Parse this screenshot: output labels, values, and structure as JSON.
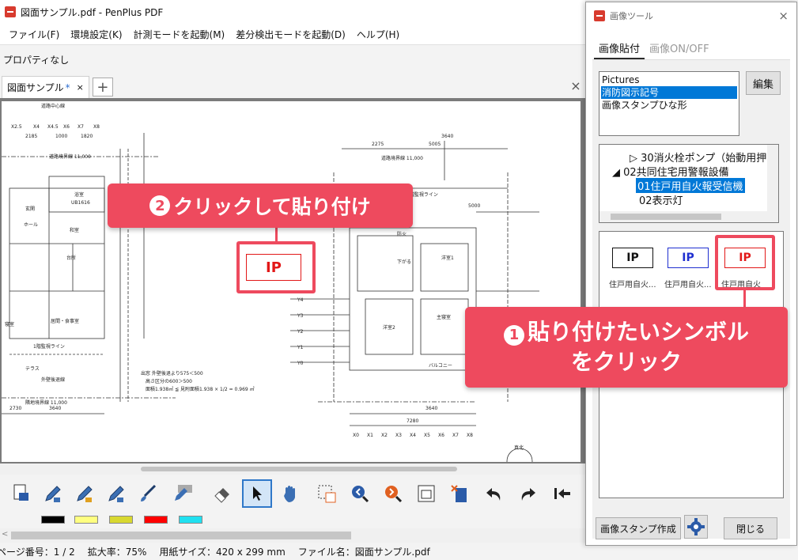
{
  "window": {
    "title": "図面サンプル.pdf - PenPlus PDF"
  },
  "menu": [
    "ファイル(F)",
    "環境設定(K)",
    "計測モードを起動(M)",
    "差分検出モードを起動(D)",
    "ヘルプ(H)"
  ],
  "properties": {
    "label": "プロパティなし"
  },
  "tab": {
    "label": "図面サンプル",
    "modified": "*",
    "close": "×",
    "add": "+",
    "close_all": "×"
  },
  "drawing": {
    "labels": [
      "道路中心線",
      "道路境界線 11,000",
      "道路境界線 11,000",
      "玄関",
      "ホール",
      "台所",
      "居間・食事室",
      "寝室",
      "浴室",
      "UB1616",
      "和室",
      "洋室1",
      "洋室2",
      "主寝室",
      "下がる",
      "テラス",
      "バルコニー",
      "外壁後退線",
      "隣地境界線 11,000",
      "1階監視ライン",
      "2階監視ライン",
      "真北",
      "防火"
    ],
    "notes": [
      "出窓 外壁後退より575＜500",
      "高さ区分の600＞500",
      "面積1.938㎡ ≦ 見附面積1.938 × 1/2 = 0.969 ㎡"
    ],
    "grid_x": [
      "X2.5",
      "X4",
      "X4.5",
      "X6",
      "X7",
      "X8"
    ],
    "grid_y": [
      "Y4",
      "Y3",
      "Y2",
      "Y1",
      "Y0"
    ],
    "grid_bottom": [
      "X0",
      "X1",
      "X2",
      "X3",
      "X4",
      "X5",
      "X6",
      "X7",
      "X8"
    ],
    "dims": [
      "2185",
      "1000",
      "1820",
      "2275",
      "5005",
      "3640",
      "5000",
      "3640",
      "2730",
      "3640",
      "7280"
    ],
    "placed_symbol": "IP"
  },
  "tools": [
    "save-icon",
    "pen-1-icon",
    "pen-2-icon",
    "pen-3-icon",
    "brush-icon",
    "text-stamp-icon",
    "eraser-icon",
    "select-cursor-icon",
    "hand-icon",
    "crop-select-icon",
    "zoom-in-icon",
    "zoom-out-icon",
    "fit-page-icon",
    "cut-image-icon",
    "undo-icon",
    "redo-icon",
    "first-page-icon"
  ],
  "colors": {
    "swatches": [
      "#000000",
      "#ffff80",
      "#d8d830",
      "#ff0000",
      "#20e0f0"
    ],
    "accent": "#ee4a5e",
    "selection": "#0078d7"
  },
  "status": {
    "page": "ページ番号：1 / 2",
    "zoom": "拡大率：75%",
    "paper": "用紙サイズ：420 x 299 mm",
    "file": "ファイル名：図面サンプル.pdf"
  },
  "panel": {
    "title": "画像ツール",
    "close": "×",
    "tabs": [
      "画像貼付",
      "画像ON/OFF"
    ],
    "list": [
      "Pictures",
      "消防図示記号",
      "画像スタンプひな形"
    ],
    "edit_button": "編集",
    "tree": {
      "row1": "▷ 30消火栓ポンプ（始動用押",
      "row2": "◢ 02共同住宅用警報設備",
      "row3": "01住戸用自火報受信機",
      "row4": "02表示灯"
    },
    "symbols": [
      {
        "text": "IP",
        "color": "#111111",
        "label": "住戸用自火..."
      },
      {
        "text": "IP",
        "color": "#1f2fd0",
        "label": "住戸用自火..."
      },
      {
        "text": "IP",
        "color": "#e21818",
        "label": "住戸用自火"
      }
    ],
    "create_button": "画像スタンプ作成",
    "close_button": "閉じる"
  },
  "annotations": {
    "step2": {
      "num": "2",
      "text": "クリックして貼り付け"
    },
    "step1": {
      "num": "1",
      "line1": "貼り付けたいシンボル",
      "line2": "をクリック"
    }
  }
}
